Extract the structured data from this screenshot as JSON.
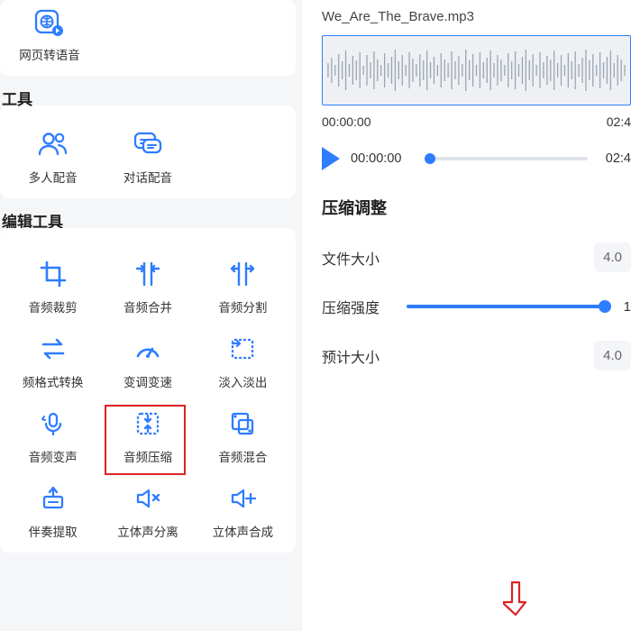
{
  "top": {
    "item_label": "网页转语音"
  },
  "section1": {
    "heading": "工具",
    "items": [
      {
        "label": "多人配音"
      },
      {
        "label": "对话配音"
      }
    ]
  },
  "section2": {
    "heading": "编辑工具",
    "items": [
      {
        "label": "音频裁剪"
      },
      {
        "label": "音频合并"
      },
      {
        "label": "音频分割"
      },
      {
        "label": "频格式转换"
      },
      {
        "label": "变调变速"
      },
      {
        "label": "淡入淡出"
      },
      {
        "label": "音频变声"
      },
      {
        "label": "音频压缩"
      },
      {
        "label": "音频混合"
      },
      {
        "label": "伴奏提取"
      },
      {
        "label": "立体声分离"
      },
      {
        "label": "立体声合成"
      }
    ]
  },
  "audio": {
    "filename": "We_Are_The_Brave.mp3",
    "t0": "00:00:00",
    "t1": "02:4",
    "play_current": "00:00:00",
    "play_total": "02:4"
  },
  "compression": {
    "title": "压缩调整",
    "file_size_label": "文件大小",
    "file_size_value": "4.0",
    "strength_label": "压缩强度",
    "strength_value": "1",
    "est_label": "预计大小",
    "est_value": "4.0"
  }
}
